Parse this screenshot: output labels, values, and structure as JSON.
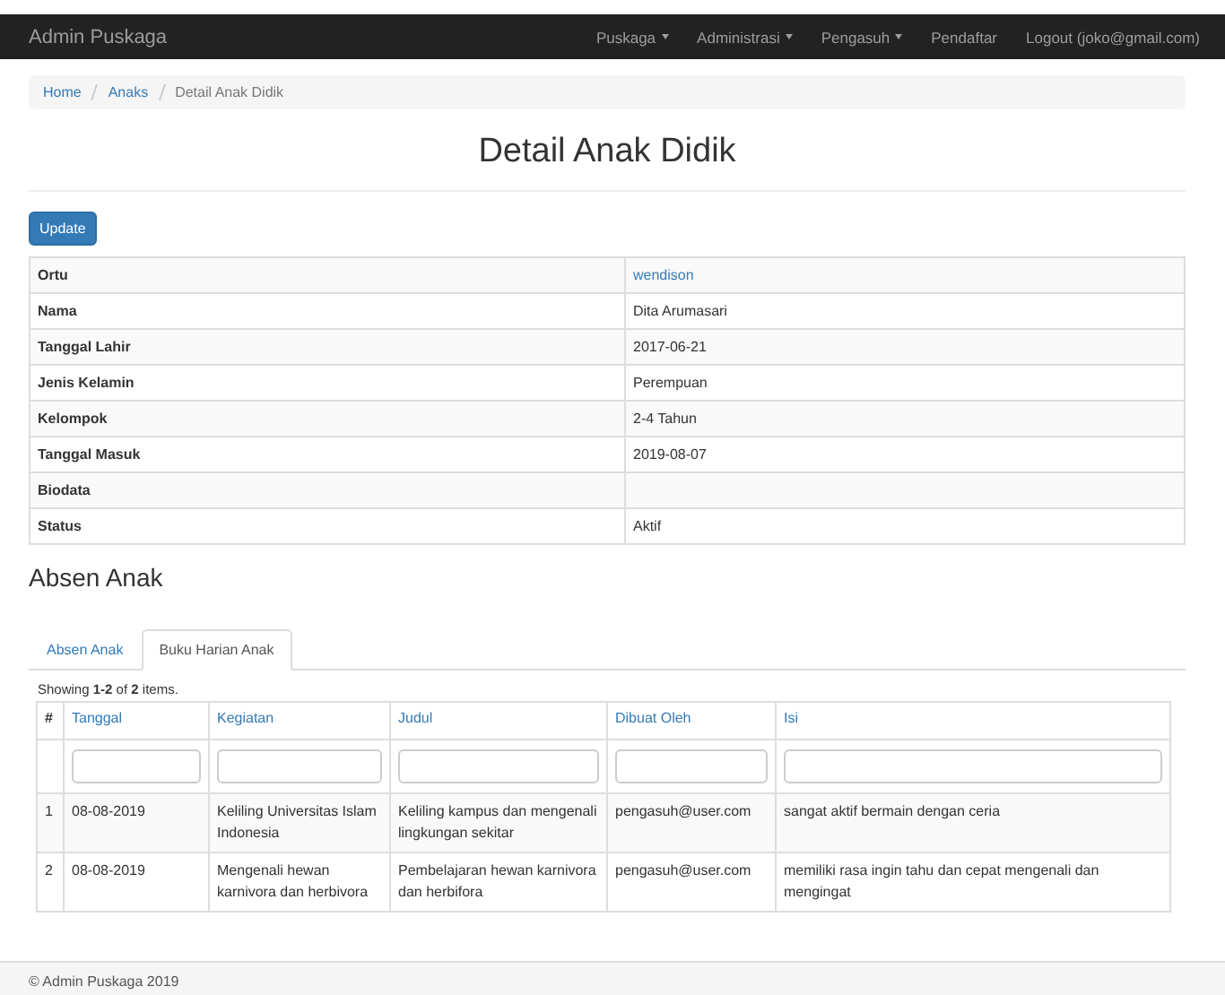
{
  "navbar": {
    "brand": "Admin Puskaga",
    "items": [
      {
        "label": "Puskaga",
        "dropdown": true
      },
      {
        "label": "Administrasi",
        "dropdown": true
      },
      {
        "label": "Pengasuh",
        "dropdown": true
      },
      {
        "label": "Pendaftar",
        "dropdown": false
      },
      {
        "label": "Logout (joko@gmail.com)",
        "dropdown": false
      }
    ]
  },
  "breadcrumb": [
    {
      "label": "Home",
      "link": true
    },
    {
      "label": "Anaks",
      "link": true
    },
    {
      "label": "Detail Anak Didik",
      "link": false
    }
  ],
  "title": "Detail Anak Didik",
  "update_button": "Update",
  "detail_rows": [
    {
      "label": "Ortu",
      "value": "wendison",
      "link": true
    },
    {
      "label": "Nama",
      "value": "Dita Arumasari"
    },
    {
      "label": "Tanggal Lahir",
      "value": "2017-06-21"
    },
    {
      "label": "Jenis Kelamin",
      "value": "Perempuan"
    },
    {
      "label": "Kelompok",
      "value": "2-4 Tahun"
    },
    {
      "label": "Tanggal Masuk",
      "value": "2019-08-07"
    },
    {
      "label": "Biodata"
    },
    {
      "label": "Status",
      "value": "Aktif"
    }
  ],
  "section_title": "Absen Anak",
  "tabs": [
    {
      "label": "Absen Anak",
      "selected": false
    },
    {
      "label": "Buku Harian Anak",
      "selected": true
    }
  ],
  "summary": "Showing **1-2** of **2** items.",
  "grid": {
    "columns": [
      {
        "label": "#",
        "sortable": false,
        "filter": false
      },
      {
        "label": "Tanggal",
        "sortable": true,
        "filter": true
      },
      {
        "label": "Kegiatan",
        "sortable": true,
        "filter": true
      },
      {
        "label": "Judul",
        "sortable": true,
        "filter": true
      },
      {
        "label": "Dibuat Oleh",
        "sortable": true,
        "filter": true
      },
      {
        "label": "Isi",
        "sortable": true,
        "filter": true
      }
    ],
    "rows": [
      [
        "1",
        "08-08-2019",
        "Keliling Universitas Islam Indonesia",
        "Keliling kampus dan mengenali lingkungan sekitar",
        "pengasuh@user.com",
        "sangat aktif bermain dengan ceria"
      ],
      [
        "2",
        "08-08-2019",
        "Mengenali hewan karnivora dan herbivora",
        "Pembelajaran hewan karnivora dan herbifora",
        "pengasuh@user.com",
        "memiliki rasa ingin tahu dan cepat mengenali dan mengingat"
      ]
    ]
  },
  "footer": "© Admin Puskaga 2019"
}
